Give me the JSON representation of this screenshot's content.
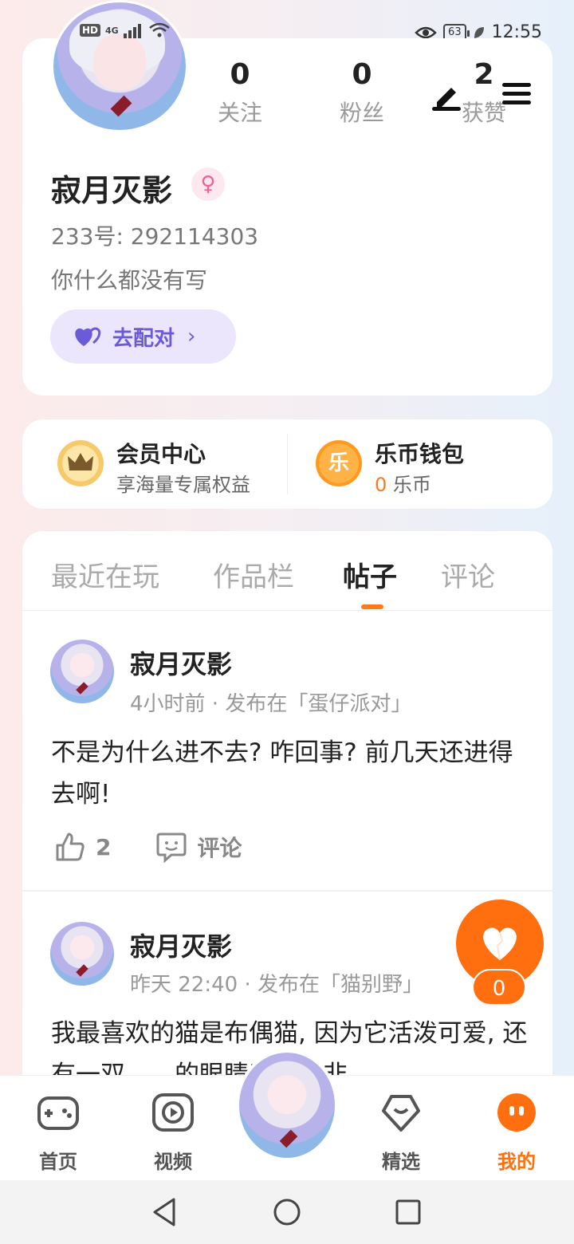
{
  "status": {
    "hd": "HD",
    "network": "4G",
    "battery": "63",
    "time": "12:55"
  },
  "profile": {
    "stats": [
      {
        "num": "0",
        "label": "关注"
      },
      {
        "num": "0",
        "label": "粉丝"
      },
      {
        "num": "2",
        "label": "获赞"
      }
    ],
    "name": "寂月灭影",
    "gender_symbol": "♀",
    "uid": "233号:  292114303",
    "bio": "你什么都没有写",
    "match_label": "去配对"
  },
  "wallet": {
    "vip_title": "会员中心",
    "vip_sub": "享海量专属权益",
    "coin_title": "乐币钱包",
    "coin_icon_char": "乐",
    "coin_count": "0",
    "coin_unit": "乐币"
  },
  "tabs": [
    "最近在玩",
    "作品栏",
    "帖子",
    "评论"
  ],
  "active_tab": "帖子",
  "posts": [
    {
      "author": "寂月灭影",
      "meta": "4小时前 · 发布在「蛋仔派对」",
      "body": "不是为什么进不去? 咋回事? 前几天还进得去啊!",
      "likes": "2",
      "comment_label": "评论"
    },
    {
      "author": "寂月灭影",
      "meta": "昨天 22:40 · 发布在「猫别野」",
      "body": "我最喜欢的猫是布偶猫, 因为它活泼可爱, 还有一双……的眼睛所以我非"
    }
  ],
  "floating_like": {
    "count": "0"
  },
  "bottom_nav": [
    {
      "label": "首页",
      "icon": "gamepad-icon"
    },
    {
      "label": "视频",
      "icon": "video-play-icon"
    },
    {
      "label": "精选",
      "icon": "heart-chat-icon"
    },
    {
      "label": "我的",
      "icon": "face-dots-icon"
    }
  ],
  "colors": {
    "accent": "#ff6f0f",
    "match": "#6b5bd8",
    "vip_gold": "#f6c96a"
  }
}
